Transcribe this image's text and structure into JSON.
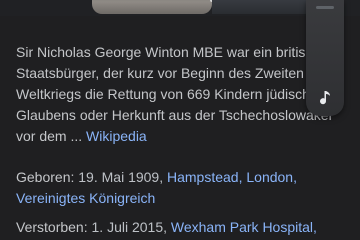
{
  "description": {
    "text": "Sir Nicholas George Winton MBE war ein britischer\nStaatsbürger, der kurz vor Beginn des Zweiten\nWeltkriegs die Rettung von 669 Kindern jüdischen\nGlaubens oder Herkunft aus der Tschechoslowakei\nvor dem ... ",
    "source_link": "Wikipedia"
  },
  "facts": {
    "born": {
      "label": "Geboren: ",
      "date": "19. Mai 1909, ",
      "place_link_1": "Hampstead, London,",
      "place_link_2": "Vereinigtes Königreich"
    },
    "died": {
      "label": "Verstorben: ",
      "date": "1. Juli 2015, ",
      "place_link": "Wexham Park Hospital,"
    }
  },
  "overlay": {
    "icon": "music-note-icon"
  },
  "colors": {
    "background": "#1f1f21",
    "text": "#c4c6c9",
    "link": "#8ab4f8"
  }
}
